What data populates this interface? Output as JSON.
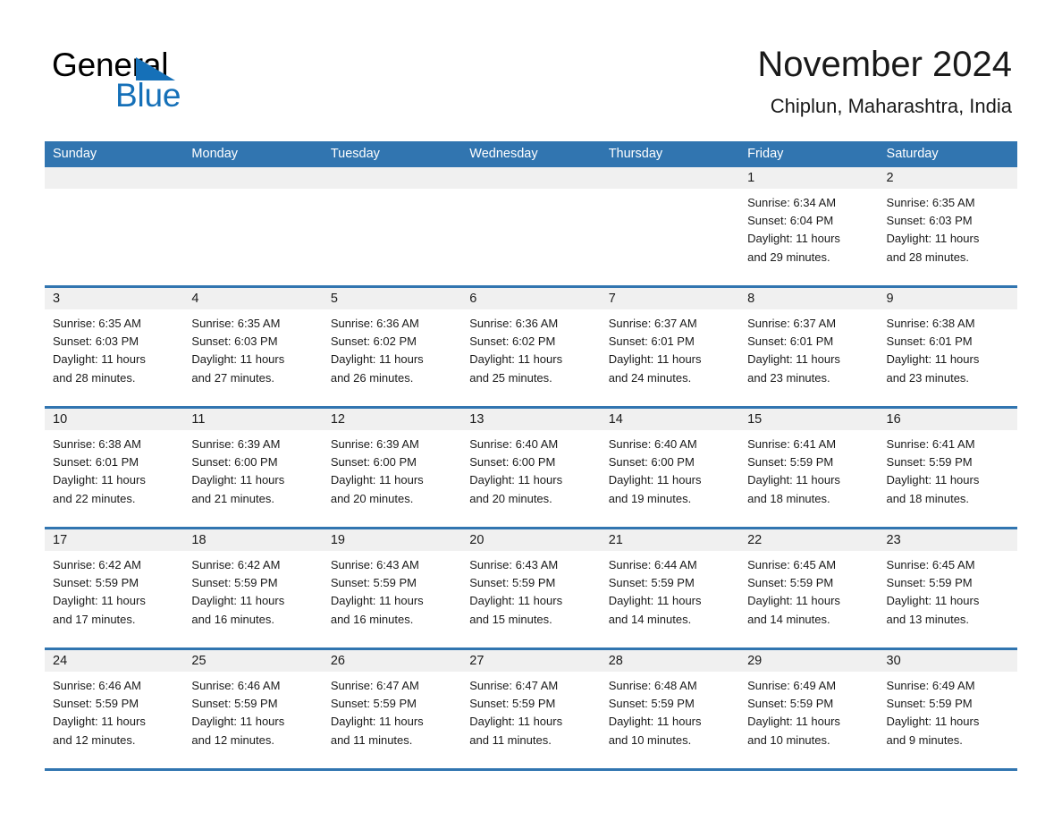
{
  "brand": {
    "word1": "General",
    "word2": "Blue",
    "triangle_color": "#1570b8",
    "accent_color": "#3175b0"
  },
  "header": {
    "month_title": "November 2024",
    "location": "Chiplun, Maharashtra, India"
  },
  "calendar": {
    "weekday_headers": [
      "Sunday",
      "Monday",
      "Tuesday",
      "Wednesday",
      "Thursday",
      "Friday",
      "Saturday"
    ],
    "labels": {
      "sunrise_prefix": "Sunrise:",
      "sunset_prefix": "Sunset:",
      "daylight_prefix": "Daylight:"
    },
    "weeks": [
      [
        {
          "day": "",
          "blank": true
        },
        {
          "day": "",
          "blank": true
        },
        {
          "day": "",
          "blank": true
        },
        {
          "day": "",
          "blank": true
        },
        {
          "day": "",
          "blank": true
        },
        {
          "day": "1",
          "sunrise": "Sunrise: 6:34 AM",
          "sunset": "Sunset: 6:04 PM",
          "daylight_l1": "Daylight: 11 hours",
          "daylight_l2": "and 29 minutes."
        },
        {
          "day": "2",
          "sunrise": "Sunrise: 6:35 AM",
          "sunset": "Sunset: 6:03 PM",
          "daylight_l1": "Daylight: 11 hours",
          "daylight_l2": "and 28 minutes."
        }
      ],
      [
        {
          "day": "3",
          "sunrise": "Sunrise: 6:35 AM",
          "sunset": "Sunset: 6:03 PM",
          "daylight_l1": "Daylight: 11 hours",
          "daylight_l2": "and 28 minutes."
        },
        {
          "day": "4",
          "sunrise": "Sunrise: 6:35 AM",
          "sunset": "Sunset: 6:03 PM",
          "daylight_l1": "Daylight: 11 hours",
          "daylight_l2": "and 27 minutes."
        },
        {
          "day": "5",
          "sunrise": "Sunrise: 6:36 AM",
          "sunset": "Sunset: 6:02 PM",
          "daylight_l1": "Daylight: 11 hours",
          "daylight_l2": "and 26 minutes."
        },
        {
          "day": "6",
          "sunrise": "Sunrise: 6:36 AM",
          "sunset": "Sunset: 6:02 PM",
          "daylight_l1": "Daylight: 11 hours",
          "daylight_l2": "and 25 minutes."
        },
        {
          "day": "7",
          "sunrise": "Sunrise: 6:37 AM",
          "sunset": "Sunset: 6:01 PM",
          "daylight_l1": "Daylight: 11 hours",
          "daylight_l2": "and 24 minutes."
        },
        {
          "day": "8",
          "sunrise": "Sunrise: 6:37 AM",
          "sunset": "Sunset: 6:01 PM",
          "daylight_l1": "Daylight: 11 hours",
          "daylight_l2": "and 23 minutes."
        },
        {
          "day": "9",
          "sunrise": "Sunrise: 6:38 AM",
          "sunset": "Sunset: 6:01 PM",
          "daylight_l1": "Daylight: 11 hours",
          "daylight_l2": "and 23 minutes."
        }
      ],
      [
        {
          "day": "10",
          "sunrise": "Sunrise: 6:38 AM",
          "sunset": "Sunset: 6:01 PM",
          "daylight_l1": "Daylight: 11 hours",
          "daylight_l2": "and 22 minutes."
        },
        {
          "day": "11",
          "sunrise": "Sunrise: 6:39 AM",
          "sunset": "Sunset: 6:00 PM",
          "daylight_l1": "Daylight: 11 hours",
          "daylight_l2": "and 21 minutes."
        },
        {
          "day": "12",
          "sunrise": "Sunrise: 6:39 AM",
          "sunset": "Sunset: 6:00 PM",
          "daylight_l1": "Daylight: 11 hours",
          "daylight_l2": "and 20 minutes."
        },
        {
          "day": "13",
          "sunrise": "Sunrise: 6:40 AM",
          "sunset": "Sunset: 6:00 PM",
          "daylight_l1": "Daylight: 11 hours",
          "daylight_l2": "and 20 minutes."
        },
        {
          "day": "14",
          "sunrise": "Sunrise: 6:40 AM",
          "sunset": "Sunset: 6:00 PM",
          "daylight_l1": "Daylight: 11 hours",
          "daylight_l2": "and 19 minutes."
        },
        {
          "day": "15",
          "sunrise": "Sunrise: 6:41 AM",
          "sunset": "Sunset: 5:59 PM",
          "daylight_l1": "Daylight: 11 hours",
          "daylight_l2": "and 18 minutes."
        },
        {
          "day": "16",
          "sunrise": "Sunrise: 6:41 AM",
          "sunset": "Sunset: 5:59 PM",
          "daylight_l1": "Daylight: 11 hours",
          "daylight_l2": "and 18 minutes."
        }
      ],
      [
        {
          "day": "17",
          "sunrise": "Sunrise: 6:42 AM",
          "sunset": "Sunset: 5:59 PM",
          "daylight_l1": "Daylight: 11 hours",
          "daylight_l2": "and 17 minutes."
        },
        {
          "day": "18",
          "sunrise": "Sunrise: 6:42 AM",
          "sunset": "Sunset: 5:59 PM",
          "daylight_l1": "Daylight: 11 hours",
          "daylight_l2": "and 16 minutes."
        },
        {
          "day": "19",
          "sunrise": "Sunrise: 6:43 AM",
          "sunset": "Sunset: 5:59 PM",
          "daylight_l1": "Daylight: 11 hours",
          "daylight_l2": "and 16 minutes."
        },
        {
          "day": "20",
          "sunrise": "Sunrise: 6:43 AM",
          "sunset": "Sunset: 5:59 PM",
          "daylight_l1": "Daylight: 11 hours",
          "daylight_l2": "and 15 minutes."
        },
        {
          "day": "21",
          "sunrise": "Sunrise: 6:44 AM",
          "sunset": "Sunset: 5:59 PM",
          "daylight_l1": "Daylight: 11 hours",
          "daylight_l2": "and 14 minutes."
        },
        {
          "day": "22",
          "sunrise": "Sunrise: 6:45 AM",
          "sunset": "Sunset: 5:59 PM",
          "daylight_l1": "Daylight: 11 hours",
          "daylight_l2": "and 14 minutes."
        },
        {
          "day": "23",
          "sunrise": "Sunrise: 6:45 AM",
          "sunset": "Sunset: 5:59 PM",
          "daylight_l1": "Daylight: 11 hours",
          "daylight_l2": "and 13 minutes."
        }
      ],
      [
        {
          "day": "24",
          "sunrise": "Sunrise: 6:46 AM",
          "sunset": "Sunset: 5:59 PM",
          "daylight_l1": "Daylight: 11 hours",
          "daylight_l2": "and 12 minutes."
        },
        {
          "day": "25",
          "sunrise": "Sunrise: 6:46 AM",
          "sunset": "Sunset: 5:59 PM",
          "daylight_l1": "Daylight: 11 hours",
          "daylight_l2": "and 12 minutes."
        },
        {
          "day": "26",
          "sunrise": "Sunrise: 6:47 AM",
          "sunset": "Sunset: 5:59 PM",
          "daylight_l1": "Daylight: 11 hours",
          "daylight_l2": "and 11 minutes."
        },
        {
          "day": "27",
          "sunrise": "Sunrise: 6:47 AM",
          "sunset": "Sunset: 5:59 PM",
          "daylight_l1": "Daylight: 11 hours",
          "daylight_l2": "and 11 minutes."
        },
        {
          "day": "28",
          "sunrise": "Sunrise: 6:48 AM",
          "sunset": "Sunset: 5:59 PM",
          "daylight_l1": "Daylight: 11 hours",
          "daylight_l2": "and 10 minutes."
        },
        {
          "day": "29",
          "sunrise": "Sunrise: 6:49 AM",
          "sunset": "Sunset: 5:59 PM",
          "daylight_l1": "Daylight: 11 hours",
          "daylight_l2": "and 10 minutes."
        },
        {
          "day": "30",
          "sunrise": "Sunrise: 6:49 AM",
          "sunset": "Sunset: 5:59 PM",
          "daylight_l1": "Daylight: 11 hours",
          "daylight_l2": "and 9 minutes."
        }
      ]
    ]
  }
}
